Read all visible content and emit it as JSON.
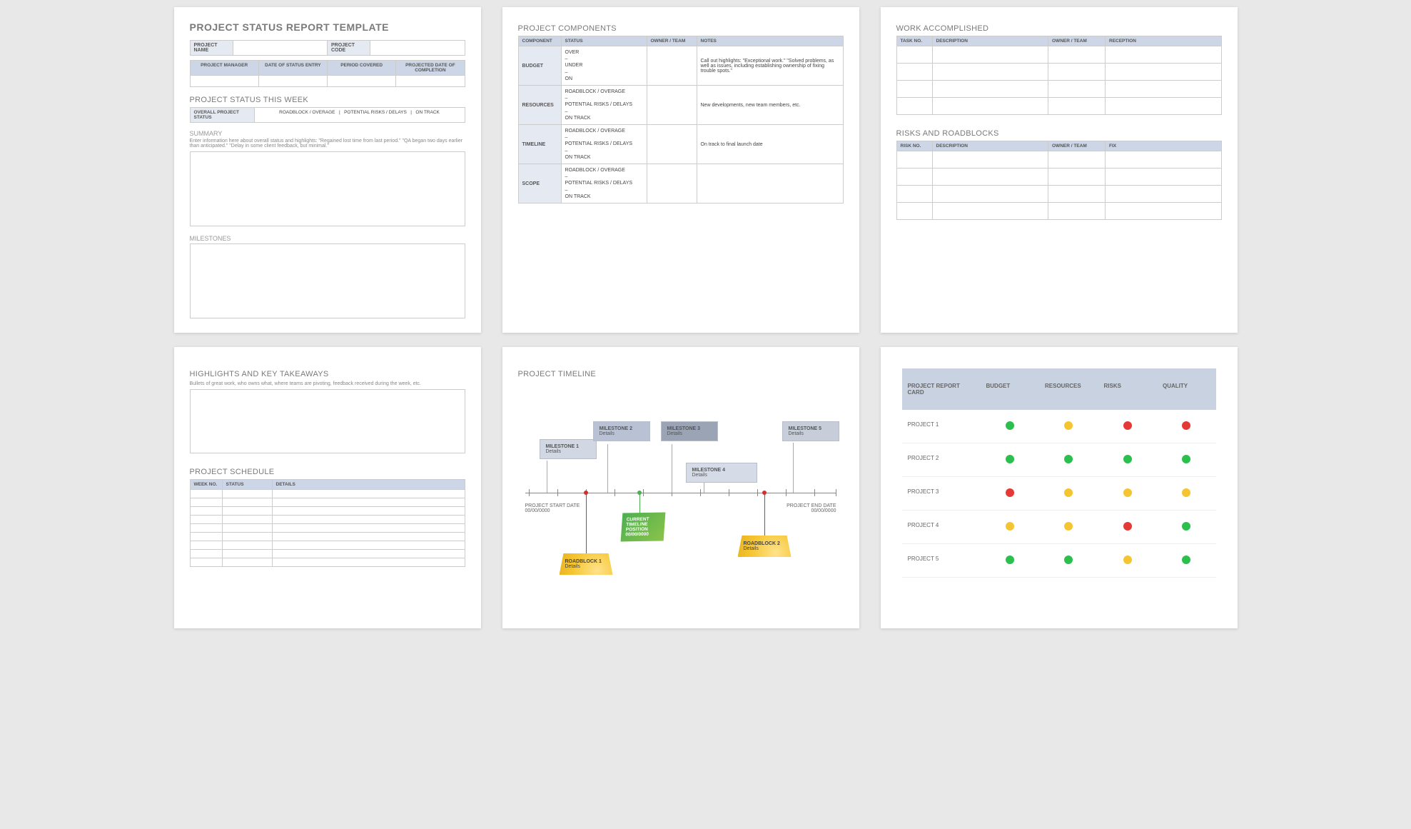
{
  "page1": {
    "title": "PROJECT STATUS REPORT TEMPLATE",
    "meta": {
      "project_name_label": "PROJECT NAME",
      "project_code_label": "PROJECT CODE",
      "pm_label": "PROJECT MANAGER",
      "date_entry_label": "DATE OF STATUS ENTRY",
      "period_label": "PERIOD COVERED",
      "projected_label": "PROJECTED DATE OF COMPLETION"
    },
    "status_week_title": "PROJECT STATUS THIS WEEK",
    "status_week": {
      "label": "OVERALL PROJECT STATUS",
      "opt1": "ROADBLOCK / OVERAGE",
      "sep": "|",
      "opt2": "POTENTIAL RISKS / DELAYS",
      "opt3": "ON TRACK"
    },
    "summary_title": "SUMMARY",
    "summary_hint": "Enter information here about overall status and highlights: \"Regained lost time from last period.\" \"QA began two days earlier than anticipated.\" \"Delay in some client feedback, but minimal.\"",
    "milestones_title": "MILESTONES"
  },
  "page2": {
    "title": "PROJECT COMPONENTS",
    "headers": {
      "component": "COMPONENT",
      "status": "STATUS",
      "owner": "OWNER / TEAM",
      "notes": "NOTES"
    },
    "rows": [
      {
        "component": "BUDGET",
        "status": "OVER\n–\nUNDER\n–\nON",
        "notes": "Call out highlights: \"Exceptional work.\" \"Solved problems, as well as issues, including establishing ownership of fixing trouble spots.\""
      },
      {
        "component": "RESOURCES",
        "status": "ROADBLOCK / OVERAGE\n–\nPOTENTIAL RISKS / DELAYS\n–\nON TRACK",
        "notes": "New developments, new team members, etc."
      },
      {
        "component": "TIMELINE",
        "status": "ROADBLOCK / OVERAGE\n–\nPOTENTIAL RISKS / DELAYS\n–\nON TRACK",
        "notes": "On track to final launch date"
      },
      {
        "component": "SCOPE",
        "status": "ROADBLOCK / OVERAGE\n–\nPOTENTIAL RISKS / DELAYS\n–\nON TRACK",
        "notes": ""
      }
    ]
  },
  "page3": {
    "work_title": "WORK ACCOMPLISHED",
    "work_headers": {
      "task": "TASK NO.",
      "desc": "DESCRIPTION",
      "owner": "OWNER / TEAM",
      "reception": "RECEPTION"
    },
    "risks_title": "RISKS AND ROADBLOCKS",
    "risks_headers": {
      "risk": "RISK NO.",
      "desc": "DESCRIPTION",
      "owner": "OWNER / TEAM",
      "fix": "FIX"
    }
  },
  "page4": {
    "highlights_title": "HIGHLIGHTS AND KEY TAKEAWAYS",
    "highlights_hint": "Bullets of great work, who owns what, where teams are pivoting, feedback received during the week, etc.",
    "schedule_title": "PROJECT SCHEDULE",
    "schedule_headers": {
      "week": "WEEK NO.",
      "status": "STATUS",
      "details": "DETAILS"
    }
  },
  "page5": {
    "title": "PROJECT TIMELINE",
    "start_label": "PROJECT START DATE",
    "start_date": "00/00/0000",
    "end_label": "PROJECT END DATE",
    "end_date": "00/00/0000",
    "milestones": [
      {
        "label": "MILESTONE 1",
        "detail": "Details"
      },
      {
        "label": "MILESTONE 2",
        "detail": "Details"
      },
      {
        "label": "MILESTONE 3",
        "detail": "Details"
      },
      {
        "label": "MILESTONE 4",
        "detail": "Details"
      },
      {
        "label": "MILESTONE 5",
        "detail": "Details"
      }
    ],
    "roadblocks": [
      {
        "label": "ROADBLOCK 1",
        "detail": "Details"
      },
      {
        "label": "ROADBLOCK 2",
        "detail": "Details"
      }
    ],
    "current": {
      "l1": "CURRENT",
      "l2": "TIMELINE",
      "l3": "POSITION",
      "date": "00/00/0000"
    }
  },
  "page6": {
    "headers": {
      "card": "PROJECT REPORT CARD",
      "budget": "BUDGET",
      "resources": "RESOURCES",
      "risks": "RISKS",
      "quality": "QUALITY"
    },
    "rows": [
      {
        "name": "PROJECT 1",
        "budget": "g",
        "resources": "y",
        "risks": "r",
        "quality": "r"
      },
      {
        "name": "PROJECT 2",
        "budget": "g",
        "resources": "g",
        "risks": "g",
        "quality": "g"
      },
      {
        "name": "PROJECT 3",
        "budget": "r",
        "resources": "y",
        "risks": "y",
        "quality": "y"
      },
      {
        "name": "PROJECT 4",
        "budget": "y",
        "resources": "y",
        "risks": "r",
        "quality": "g"
      },
      {
        "name": "PROJECT 5",
        "budget": "g",
        "resources": "g",
        "risks": "y",
        "quality": "g"
      }
    ]
  }
}
